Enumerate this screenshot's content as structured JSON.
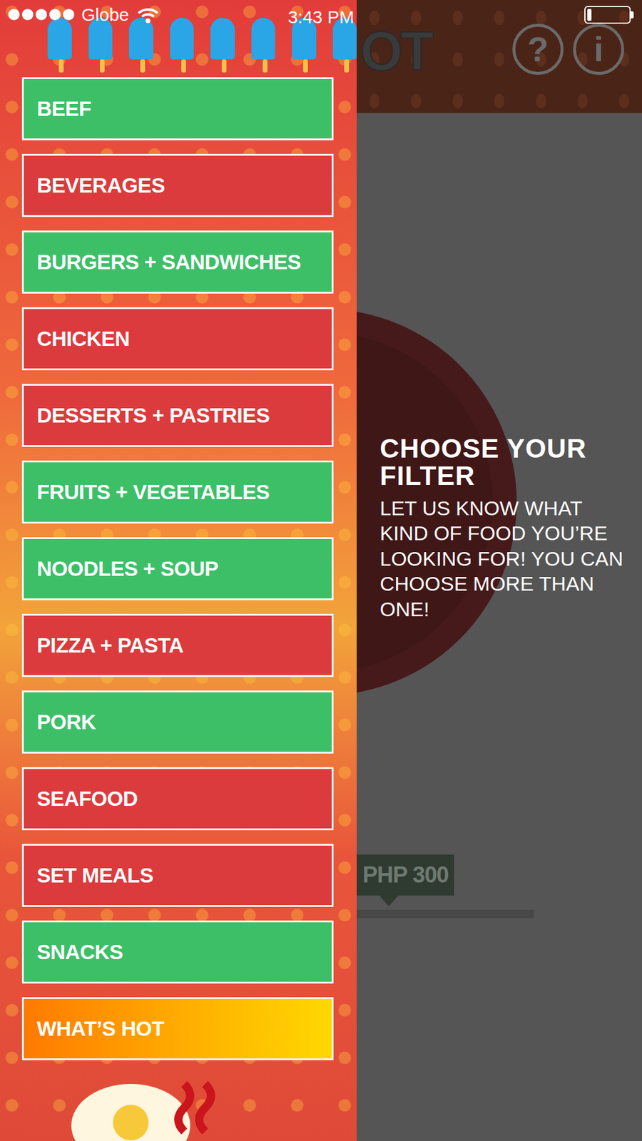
{
  "status_bar": {
    "signal": [
      {
        "filled": true
      },
      {
        "filled": true
      },
      {
        "filled": true
      },
      {
        "filled": true
      },
      {
        "filled": true
      }
    ],
    "carrier": "Globe",
    "time": "3:43 PM",
    "battery": {
      "level": 0.1
    }
  },
  "header": {
    "logo": "OT",
    "buttons": [
      {
        "label": "?"
      },
      {
        "label": "i"
      }
    ]
  },
  "filters": [
    {
      "label": "BEEF",
      "color": "#3dbf68",
      "kind": "plain",
      "selected": false
    },
    {
      "label": "BEVERAGES",
      "color": "#dc3b3d",
      "kind": "plain",
      "selected": false
    },
    {
      "label": "BURGERS + SANDWICHES",
      "color": "#3dbf68",
      "kind": "plain",
      "selected": false
    },
    {
      "label": "CHICKEN",
      "color": "#dc3b3d",
      "kind": "plain",
      "selected": false
    },
    {
      "label": "DESSERTS + PASTRIES",
      "color": "#dc3b3d",
      "kind": "plain",
      "selected": false
    },
    {
      "label": "FRUITS + VEGETABLES",
      "color": "#3dbf68",
      "kind": "plain",
      "selected": false
    },
    {
      "label": "NOODLES + SOUP",
      "color": "#3dbf68",
      "kind": "plain",
      "selected": false
    },
    {
      "label": "PIZZA + PASTA",
      "color": "#dc3b3d",
      "kind": "plain",
      "selected": false
    },
    {
      "label": "PORK",
      "color": "#3dbf68",
      "kind": "plain",
      "selected": false
    },
    {
      "label": "SEAFOOD",
      "color": "#dc3b3d",
      "kind": "plain",
      "selected": false
    },
    {
      "label": "SET MEALS",
      "color": "#dc3b3d",
      "kind": "plain",
      "selected": false
    },
    {
      "label": "SNACKS",
      "color": "#3dbf68",
      "kind": "plain",
      "selected": false
    },
    {
      "label": "WHAT’S HOT",
      "color": "#ff7a00",
      "kind": "gradient",
      "selected": false
    }
  ],
  "hint": {
    "title": "CHOOSE YOUR FILTER",
    "body": "LET US KNOW WHAT KIND OF FOOD YOU’RE LOOKING FOR! YOU CAN CHOOSE MORE THAN ONE!"
  },
  "price": {
    "label": "PHP 300"
  }
}
